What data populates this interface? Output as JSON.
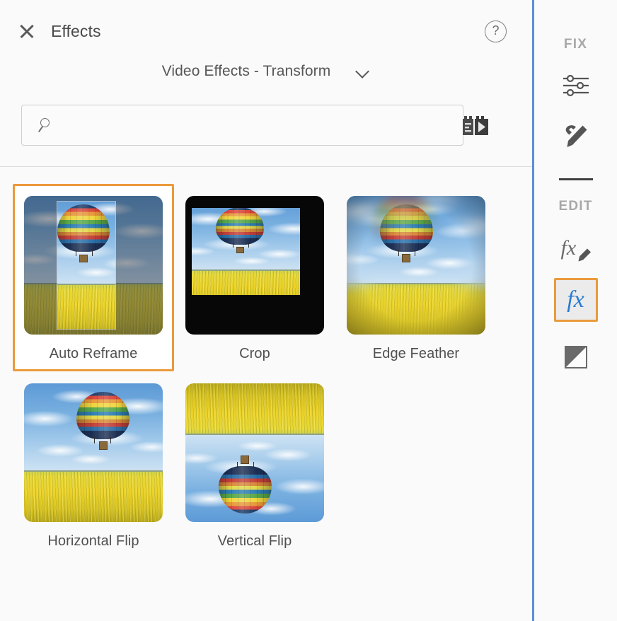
{
  "panel": {
    "title": "Effects",
    "close_icon": "close-icon",
    "help_icon": "help-icon",
    "category": {
      "label": "Video Effects - Transform",
      "chevron_icon": "chevron-down-icon"
    },
    "search": {
      "value": "",
      "placeholder": "",
      "icon": "search-icon"
    },
    "presets_button_icon": "presets-icon"
  },
  "effects": [
    {
      "label": "Auto Reframe",
      "thumb": "auto-reframe",
      "selected": true
    },
    {
      "label": "Crop",
      "thumb": "crop",
      "selected": false
    },
    {
      "label": "Edge Feather",
      "thumb": "edge-feather",
      "selected": false
    },
    {
      "label": "Horizontal Flip",
      "thumb": "horizontal-flip",
      "selected": false
    },
    {
      "label": "Vertical Flip",
      "thumb": "vertical-flip",
      "selected": false
    }
  ],
  "rail": {
    "fix_label": "FIX",
    "edit_label": "EDIT",
    "items": [
      {
        "icon": "sliders-icon",
        "active": false
      },
      {
        "icon": "tools-hammer-pencil-icon",
        "active": false
      },
      {
        "icon": "fx-pencil-icon",
        "active": false
      },
      {
        "icon": "fx-icon",
        "label": "fx",
        "active": true
      },
      {
        "icon": "gradient-square-icon",
        "active": false
      }
    ]
  },
  "colors": {
    "accent_orange": "#eb9a3c",
    "rail_divider_blue": "#5b8fd4",
    "fx_blue": "#2b7cd3",
    "panel_bg": "#fafafa",
    "text_gray": "#505050"
  }
}
